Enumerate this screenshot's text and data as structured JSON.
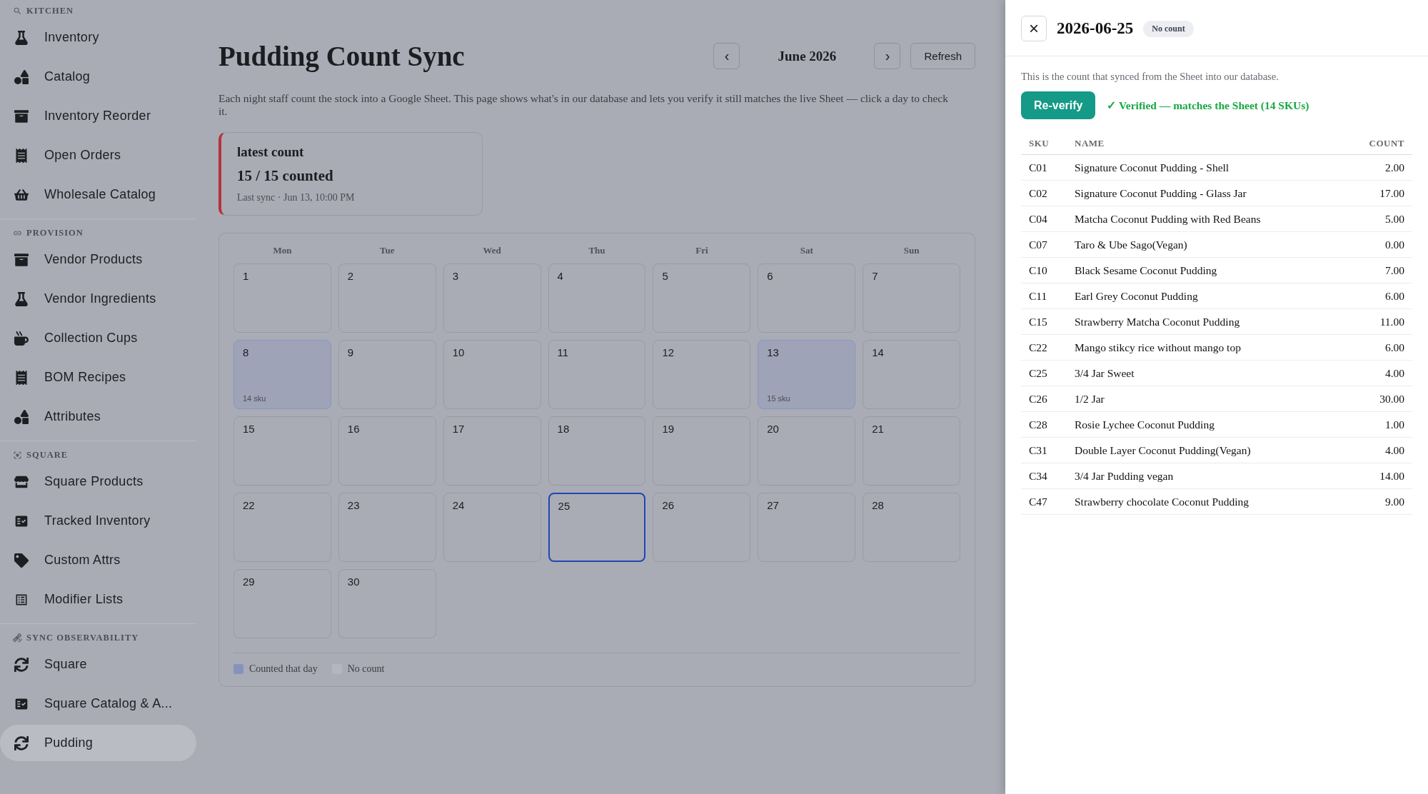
{
  "sidebar": {
    "sections": [
      {
        "heading": "KITCHEN",
        "items": [
          {
            "label": "Inventory",
            "selected": false
          },
          {
            "label": "Catalog",
            "selected": false
          },
          {
            "label": "Inventory Reorder",
            "selected": false
          },
          {
            "label": "Open Orders",
            "selected": false
          },
          {
            "label": "Wholesale Catalog",
            "selected": false
          }
        ]
      },
      {
        "heading": "PROVISION",
        "items": [
          {
            "label": "Vendor Products",
            "selected": false
          },
          {
            "label": "Vendor Ingredients",
            "selected": false
          },
          {
            "label": "Collection Cups",
            "selected": false
          },
          {
            "label": "BOM Recipes",
            "selected": false
          },
          {
            "label": "Attributes",
            "selected": false
          }
        ]
      },
      {
        "heading": "SQUARE",
        "items": [
          {
            "label": "Square Products",
            "selected": false
          },
          {
            "label": "Tracked Inventory",
            "selected": false
          },
          {
            "label": "Custom Attrs",
            "selected": false
          },
          {
            "label": "Modifier Lists",
            "selected": false
          }
        ]
      },
      {
        "heading": "SYNC OBSERVABILITY",
        "items": [
          {
            "label": "Square",
            "selected": false
          },
          {
            "label": "Square Catalog & A...",
            "selected": false
          },
          {
            "label": "Pudding",
            "selected": true
          }
        ]
      }
    ]
  },
  "page": {
    "title": "Pudding Count Sync",
    "month": "June 2026",
    "prev": "‹",
    "next": "›",
    "refresh": "Refresh",
    "description": "Each night staff count the stock into a Google Sheet. This page shows what's in our database and lets you verify it still matches the live Sheet — click a day to check it.",
    "latest": {
      "heading": "latest count",
      "value": "15 / 15 counted",
      "sync": "Last sync · Jun 13, 10:00 PM"
    }
  },
  "calendar": {
    "weekdays": [
      "Mon",
      "Tue",
      "Wed",
      "Thu",
      "Fri",
      "Sat",
      "Sun"
    ],
    "days": [
      {
        "day": "1",
        "counted": false,
        "selected": false
      },
      {
        "day": "2",
        "counted": false,
        "selected": false
      },
      {
        "day": "3",
        "counted": false,
        "selected": false
      },
      {
        "day": "4",
        "counted": false,
        "selected": false
      },
      {
        "day": "5",
        "counted": false,
        "selected": false
      },
      {
        "day": "6",
        "counted": false,
        "selected": false
      },
      {
        "day": "7",
        "counted": false,
        "selected": false
      },
      {
        "day": "8",
        "counted": true,
        "selected": false,
        "sku": "14 sku"
      },
      {
        "day": "9",
        "counted": false,
        "selected": false
      },
      {
        "day": "10",
        "counted": false,
        "selected": false
      },
      {
        "day": "11",
        "counted": false,
        "selected": false
      },
      {
        "day": "12",
        "counted": false,
        "selected": false
      },
      {
        "day": "13",
        "counted": true,
        "selected": false,
        "sku": "15 sku"
      },
      {
        "day": "14",
        "counted": false,
        "selected": false
      },
      {
        "day": "15",
        "counted": false,
        "selected": false
      },
      {
        "day": "16",
        "counted": false,
        "selected": false
      },
      {
        "day": "17",
        "counted": false,
        "selected": false
      },
      {
        "day": "18",
        "counted": false,
        "selected": false
      },
      {
        "day": "19",
        "counted": false,
        "selected": false
      },
      {
        "day": "20",
        "counted": false,
        "selected": false
      },
      {
        "day": "21",
        "counted": false,
        "selected": false
      },
      {
        "day": "22",
        "counted": false,
        "selected": false
      },
      {
        "day": "23",
        "counted": false,
        "selected": false
      },
      {
        "day": "24",
        "counted": false,
        "selected": false
      },
      {
        "day": "25",
        "counted": false,
        "selected": true
      },
      {
        "day": "26",
        "counted": false,
        "selected": false
      },
      {
        "day": "27",
        "counted": false,
        "selected": false
      },
      {
        "day": "28",
        "counted": false,
        "selected": false
      },
      {
        "day": "29",
        "counted": false,
        "selected": false
      },
      {
        "day": "30",
        "counted": false,
        "selected": false
      }
    ],
    "legend": [
      {
        "label": "Counted that day",
        "color": "#8492bd"
      },
      {
        "label": "No count",
        "color": "#b3b6bf"
      }
    ]
  },
  "drawer": {
    "close": "×",
    "date": "2026-06-25",
    "badge": "No count",
    "description": "This is the count that synced from the Sheet into our database.",
    "button": "Re-verify",
    "status": "✓ Verified — matches the Sheet (14 SKUs)",
    "columns": [
      "SKU",
      "NAME",
      "COUNT"
    ],
    "rows": [
      [
        "C01",
        "Signature Coconut Pudding - Shell",
        "2.00"
      ],
      [
        "C02",
        "Signature Coconut Pudding - Glass Jar",
        "17.00"
      ],
      [
        "C04",
        "Matcha Coconut Pudding with Red Beans",
        "5.00"
      ],
      [
        "C07",
        "Taro & Ube Sago(Vegan)",
        "0.00"
      ],
      [
        "C10",
        "Black Sesame Coconut Pudding",
        "7.00"
      ],
      [
        "C11",
        "Earl Grey Coconut Pudding",
        "6.00"
      ],
      [
        "C15",
        "Strawberry Matcha Coconut Pudding",
        "11.00"
      ],
      [
        "C22",
        "Mango stikcy rice without mango top",
        "6.00"
      ],
      [
        "C25",
        "3/4 Jar Sweet",
        "4.00"
      ],
      [
        "C26",
        "1/2 Jar",
        "30.00"
      ],
      [
        "C28",
        "Rosie Lychee Coconut Pudding",
        "1.00"
      ],
      [
        "C31",
        "Double Layer Coconut Pudding(Vegan)",
        "4.00"
      ],
      [
        "C34",
        "3/4 Jar Pudding vegan",
        "14.00"
      ],
      [
        "C47",
        "Strawberry chocolate Coconut Pudding",
        "9.00"
      ]
    ]
  }
}
